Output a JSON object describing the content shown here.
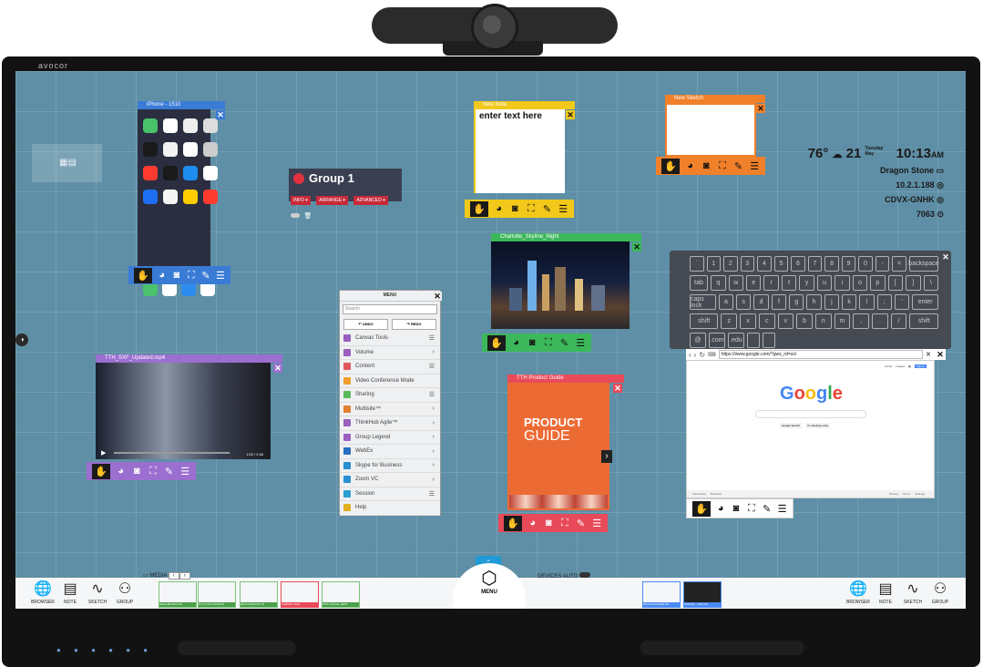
{
  "status": {
    "temperature": "76°",
    "weather_icon": "partly-cloudy-icon",
    "date_num": "21",
    "weekday": "Tuesday",
    "month": "May",
    "time": "10:13",
    "ampm": "AM",
    "room": "Dragon Stone",
    "ip": "10.2.1.188",
    "code": "CDVX-GNHK",
    "pin": "7063"
  },
  "brand": "avocor",
  "phone_window": {
    "title": "iPhone - 1510"
  },
  "group": {
    "title": "Group 1",
    "pills": [
      "INFO ▾",
      "ARRANGE ▾",
      "ADVANCED ▾"
    ]
  },
  "note": {
    "title": "New Note",
    "body": "enter text here"
  },
  "sketch": {
    "title": "New Sketch"
  },
  "photo": {
    "title": "Charlotte_Skyline_Night"
  },
  "video": {
    "title": "TTH_SXF_Updated.mp4",
    "time": "1:02 / 2:46"
  },
  "guide": {
    "title": "TTH Product Guide",
    "line1": "PRODUCT",
    "line2": "GUIDE"
  },
  "menu": {
    "title": "MENU",
    "search_placeholder": "Search",
    "undo": "UNDO",
    "redo": "REDO",
    "items": [
      {
        "label": "Canvas Tools",
        "color": "#9b5fc0",
        "right": "☰"
      },
      {
        "label": "Volume",
        "color": "#9b5fc0",
        "right": "›"
      },
      {
        "label": "Content",
        "color": "#e0555a",
        "right": "☰"
      },
      {
        "label": "Video Conference Mode",
        "color": "#f0a030",
        "right": ""
      },
      {
        "label": "Sharing",
        "color": "#5cb85c",
        "right": "☰"
      },
      {
        "label": "Multisite™",
        "color": "#e08030",
        "right": "›"
      },
      {
        "label": "ThinkHub Agile™",
        "color": "#9b5fc0",
        "right": "›"
      },
      {
        "label": "Group Legend",
        "color": "#9b5fc0",
        "right": "›"
      },
      {
        "label": "WebEx",
        "color": "#2a6fc0",
        "right": "›"
      },
      {
        "label": "Skype for Business",
        "color": "#2a8fd0",
        "right": "›"
      },
      {
        "label": "Zoom VC",
        "color": "#2a8fd0",
        "right": "›"
      },
      {
        "label": "Session",
        "color": "#2a9fd0",
        "right": "☰"
      },
      {
        "label": "Help",
        "color": "#e0b020",
        "right": ""
      }
    ]
  },
  "keyboard": {
    "rows": [
      [
        "`",
        "1",
        "2",
        "3",
        "4",
        "5",
        "6",
        "7",
        "8",
        "9",
        "0",
        "-",
        "=",
        "backspace"
      ],
      [
        "tab",
        "q",
        "w",
        "e",
        "r",
        "t",
        "y",
        "u",
        "i",
        "o",
        "p",
        "[",
        "]",
        "\\"
      ],
      [
        "caps lock",
        "a",
        "s",
        "d",
        "f",
        "g",
        "h",
        "j",
        "k",
        "l",
        ";",
        "'",
        "enter"
      ],
      [
        "shift",
        "z",
        "x",
        "c",
        "v",
        "b",
        "n",
        "m",
        ",",
        ".",
        "/",
        "shift"
      ],
      [
        "@",
        ".com",
        ".edu",
        "",
        ""
      ]
    ]
  },
  "browser": {
    "url": "https://www.google.com/?gws_rd=ssl",
    "logo": "Google",
    "search_btn": "Google Search",
    "lucky_btn": "I'm Feeling Lucky",
    "top_links": [
      "Gmail",
      "Images",
      "Sign in"
    ],
    "footer_left": [
      "Advertising",
      "Business"
    ],
    "footer_right": [
      "Privacy",
      "Terms",
      "Settings"
    ]
  },
  "dock": {
    "left_buttons": [
      "BROWSER",
      "NOTE",
      "SKETCH",
      "GROUP"
    ],
    "right_buttons": [
      "BROWSER",
      "NOTE",
      "SKETCH",
      "GROUP"
    ],
    "media_label": "MEDIA",
    "media_thumbs": [
      "NEIGHBORHOOD",
      "NYC POP GROWTH",
      "RESTAURANTS W",
      "SUBWAY MAP",
      "POP CASUAL REST"
    ],
    "menu_label": "MENU",
    "devices_label": "DEVICES",
    "auto_label": "AUTO",
    "device_thumbs": [
      "DRAGONSTONE PR",
      "IPHONE - 1510 FR"
    ]
  },
  "colors": {
    "canvas": "#5e8fa6",
    "phone": "#3a7bd5",
    "note": "#f2c81a",
    "sketch": "#f0802a",
    "photo": "#3cb85a",
    "video": "#9b6fd0",
    "guide": "#e84a5a",
    "browser": "#ffffff"
  }
}
